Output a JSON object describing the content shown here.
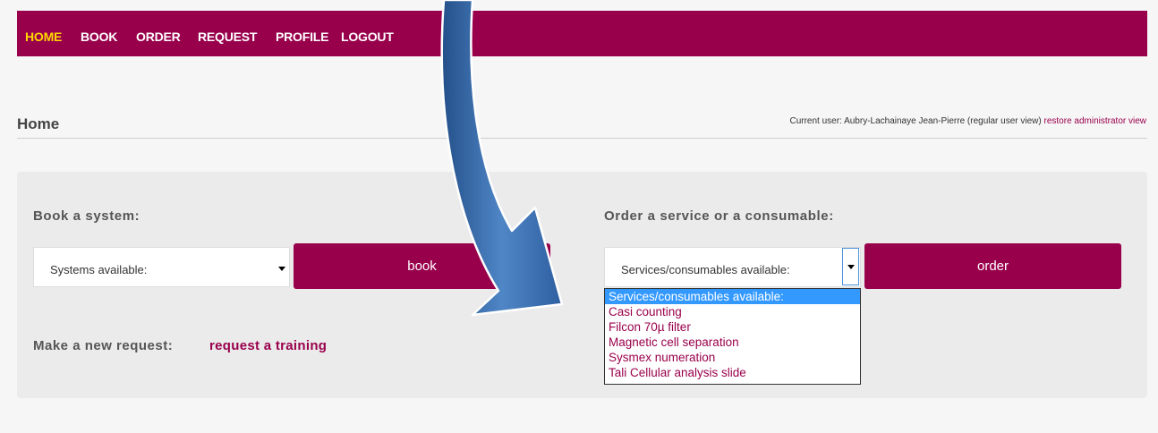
{
  "nav": {
    "items": [
      {
        "label": "HOME",
        "active": true
      },
      {
        "label": "BOOK"
      },
      {
        "label": "ORDER"
      },
      {
        "label": "REQUEST"
      },
      {
        "label": "PROFILE"
      },
      {
        "label": "LOGOUT"
      }
    ]
  },
  "header": {
    "title": "Home",
    "current_user_text": "Current user: Aubry-Lachainaye Jean-Pierre (regular user view)",
    "restore_link": "restore administrator view"
  },
  "book": {
    "label": "Book a system:",
    "select_value": "Systems available:",
    "button_label": "book"
  },
  "order": {
    "label": "Order a service or a consumable:",
    "select_value": "Services/consumables available:",
    "button_label": "order",
    "options": [
      "Services/consumables available:",
      "Casi counting",
      "Filcon 70µ filter",
      "Magnetic cell separation",
      "Sysmex numeration",
      "Tali Cellular analysis slide"
    ]
  },
  "request": {
    "label": "Make a new request:",
    "link": "request a training"
  },
  "colors": {
    "brand": "#99004c",
    "active_nav": "#ffd800",
    "selection": "#3399ff",
    "arrow": "#2e5fa1"
  }
}
